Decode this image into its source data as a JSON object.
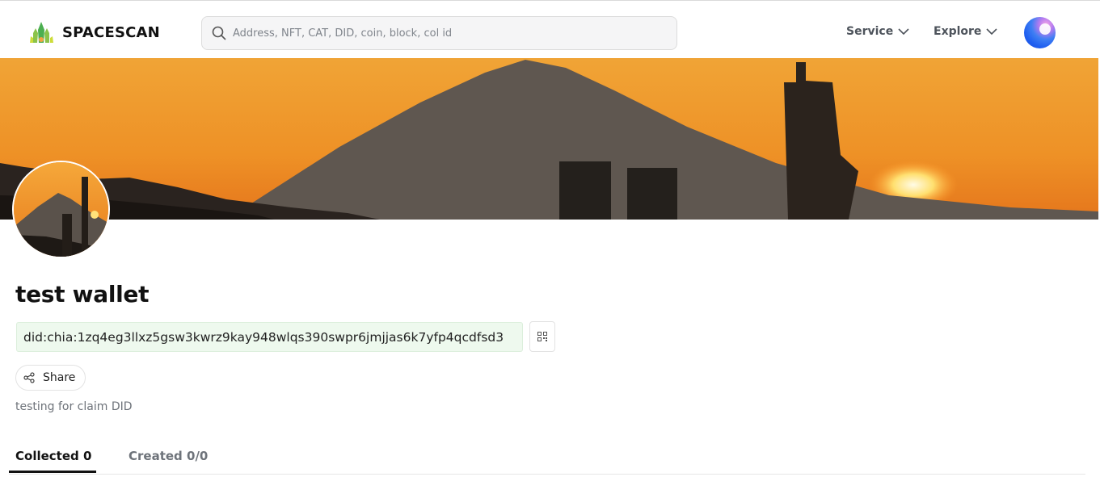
{
  "header": {
    "logo_text": "SPACESCAN",
    "search_placeholder": "Address, NFT, CAT, DID, coin, block, col id",
    "nav": [
      {
        "label": "Service"
      },
      {
        "label": "Explore"
      }
    ]
  },
  "profile": {
    "name": "test wallet",
    "did": "did:chia:1zq4eg3llxz5gsw3kwrz9kay948wlqs390swpr6jmjjas6k7yfp4qcdfsd3",
    "share_label": "Share",
    "description": "testing for claim DID"
  },
  "tabs": [
    {
      "label": "Collected 0",
      "active": true
    },
    {
      "label": "Created 0/0",
      "active": false
    }
  ],
  "icons": {
    "search": "search-icon",
    "chevron": "chevron-down-icon",
    "qr": "qr-code-icon",
    "share": "share-icon"
  },
  "colors": {
    "did_background": "#eef9ee",
    "sky_orange": "#f09a2a",
    "text_primary": "#111111",
    "text_muted": "#6e737a"
  }
}
